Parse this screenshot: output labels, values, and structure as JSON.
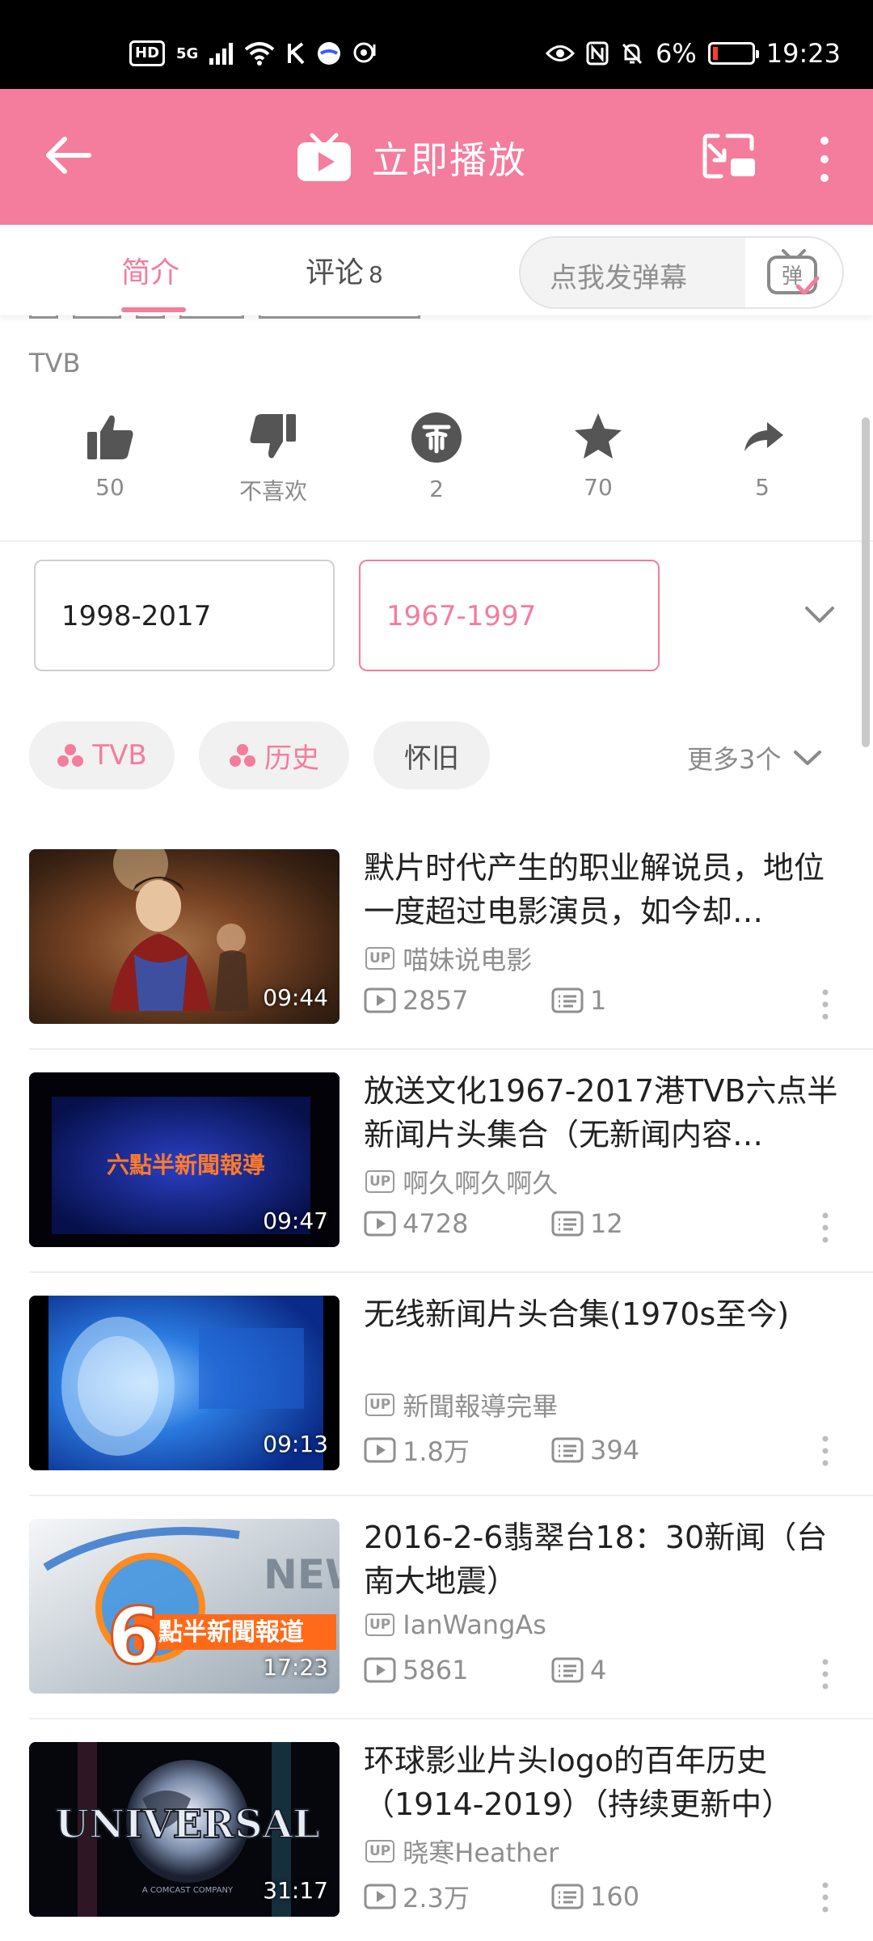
{
  "status_bar": {
    "hd": "HD",
    "network": "5G",
    "battery_percent": "6%",
    "time": "19:23",
    "icons": [
      "hd-icon",
      "signal-icon",
      "wifi-icon",
      "k-icon",
      "app-icon",
      "hotspot-icon",
      "eye-icon",
      "nfc-icon",
      "mute-icon",
      "battery-icon"
    ]
  },
  "header": {
    "title": "立即播放",
    "icons": [
      "back-arrow-icon",
      "tv-play-icon",
      "cast-icon",
      "more-vertical-icon"
    ]
  },
  "tabs": {
    "intro": "简介",
    "comments": "评论",
    "comments_count": "8",
    "danmaku_placeholder": "点我发弹幕",
    "danmaku_button_icon": "danmaku-icon"
  },
  "uploader_tag": "TVB",
  "actions": [
    {
      "name": "like",
      "icon": "thumbs-up-icon",
      "label": "50"
    },
    {
      "name": "dislike",
      "icon": "thumbs-down-icon",
      "label": "不喜欢"
    },
    {
      "name": "coin",
      "icon": "coin-icon",
      "label": "2"
    },
    {
      "name": "favorite",
      "icon": "star-icon",
      "label": "70"
    },
    {
      "name": "share",
      "icon": "share-icon",
      "label": "5"
    }
  ],
  "seasons": [
    {
      "label": "1998-2017",
      "selected": false
    },
    {
      "label": "1967-1997",
      "selected": true
    }
  ],
  "tags": [
    {
      "label": "TVB",
      "channel": true
    },
    {
      "label": "历史",
      "channel": true
    },
    {
      "label": "怀旧",
      "channel": false
    }
  ],
  "more_tags": "更多3个",
  "videos": [
    {
      "title": "默片时代产生的职业解说员，地位一度超过电影演员，如今却…",
      "up": "喵妹说电影",
      "plays": "2857",
      "danmaku": "1",
      "duration": "09:44"
    },
    {
      "title": "放送文化1967-2017港TVB六点半新闻片头集合（无新闻内容…",
      "up": "啊久啊久啊久",
      "plays": "4728",
      "danmaku": "12",
      "duration": "09:47",
      "thumb_text": "六點半新聞報導"
    },
    {
      "title": "无线新闻片头合集(1970s至今)",
      "up": "新聞報導完畢",
      "plays": "1.8万",
      "danmaku": "394",
      "duration": "09:13"
    },
    {
      "title": "2016-2-6翡翠台18：30新闻（台南大地震）",
      "up": "IanWangAs",
      "plays": "5861",
      "danmaku": "4",
      "duration": "17:23",
      "thumb_text": "點半新聞報道",
      "thumb_number": "6",
      "thumb_word": "NEW"
    },
    {
      "title": "环球影业片头logo的百年历史（1914-2019）（持续更新中）",
      "up": "晓寒Heather",
      "plays": "2.3万",
      "danmaku": "160",
      "duration": "31:17",
      "thumb_text": "UNIVERSAL",
      "thumb_sub": "A COMCAST COMPANY"
    }
  ],
  "up_badge": "UP",
  "colors": {
    "accent": "#f47c9c",
    "status_bar": "#000000",
    "text_secondary": "#8f8f8f"
  }
}
